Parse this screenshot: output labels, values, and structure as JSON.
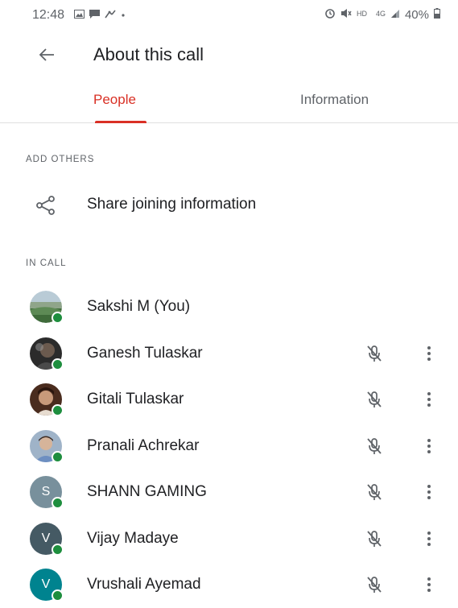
{
  "status_bar": {
    "time": "12:48",
    "battery": "40%",
    "left_icons": [
      "gallery-icon",
      "message-icon",
      "signal-alt-icon",
      "dot-icon"
    ],
    "right_icons": [
      "alarm-icon",
      "mute-icon",
      "hd-volte-icon",
      "data-icon",
      "signal-icon",
      "battery-icon"
    ]
  },
  "app_bar": {
    "back_icon": "arrow-back-icon",
    "title": "About this call"
  },
  "tabs": [
    {
      "label": "People",
      "active": true
    },
    {
      "label": "Information",
      "active": false
    }
  ],
  "accent_color": "#d93025",
  "online_color": "#1e8e3e",
  "sections": {
    "add_others": "ADD OTHERS",
    "in_call": "IN CALL"
  },
  "share": {
    "icon": "share-icon",
    "label": "Share joining information"
  },
  "participants": [
    {
      "name": "Sakshi M (You)",
      "avatar": "photo",
      "online": true,
      "muted": false,
      "has_menu": false
    },
    {
      "name": "Ganesh Tulaskar",
      "avatar": "photo",
      "online": true,
      "muted": true,
      "has_menu": true
    },
    {
      "name": "Gitali Tulaskar",
      "avatar": "photo",
      "online": true,
      "muted": true,
      "has_menu": true
    },
    {
      "name": "Pranali Achrekar",
      "avatar": "photo",
      "online": true,
      "muted": true,
      "has_menu": true
    },
    {
      "name": "SHANN GAMING",
      "avatar_letter": "S",
      "avatar_color": "#78909c",
      "online": true,
      "muted": true,
      "has_menu": true
    },
    {
      "name": "Vijay Madaye",
      "avatar_letter": "V",
      "avatar_color": "#455a64",
      "online": true,
      "muted": true,
      "has_menu": true
    },
    {
      "name": "Vrushali Ayemad",
      "avatar_letter": "V",
      "avatar_color": "#00838f",
      "online": true,
      "muted": true,
      "has_menu": true
    }
  ]
}
